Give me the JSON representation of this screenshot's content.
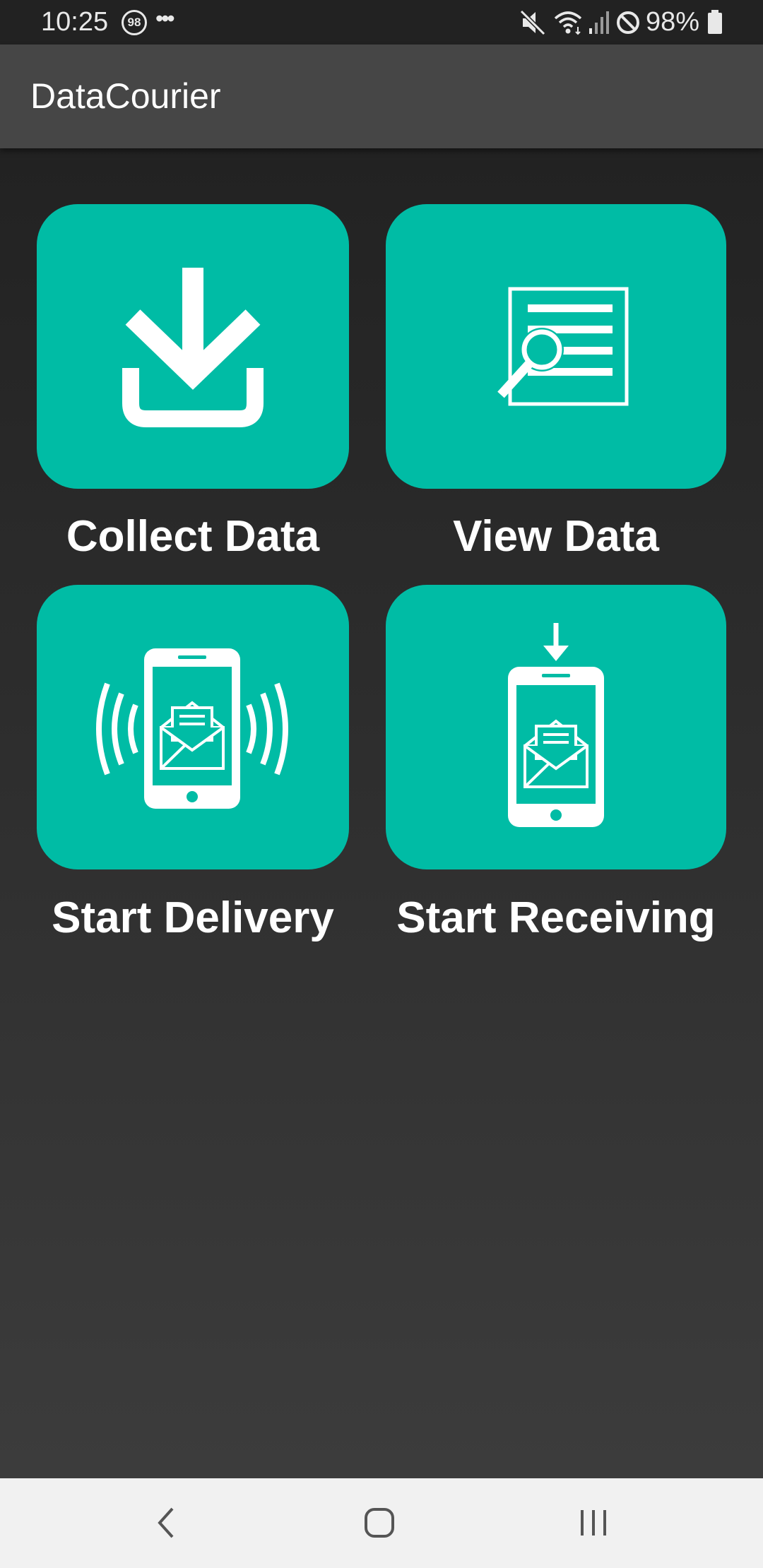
{
  "status_bar": {
    "time": "10:25",
    "notification_count": "98",
    "more_indicator": "•••",
    "battery": "98%",
    "icons": [
      "mute-icon",
      "wifi-icon",
      "signal-icon",
      "do-not-disturb-icon",
      "battery-icon"
    ]
  },
  "app_bar": {
    "title": "DataCourier"
  },
  "tiles": [
    {
      "label": "Collect Data",
      "icon": "download-icon"
    },
    {
      "label": "View Data",
      "icon": "document-search-icon"
    },
    {
      "label": "Start Delivery",
      "icon": "phone-broadcast-mail-icon"
    },
    {
      "label": "Start Receiving",
      "icon": "phone-receive-mail-icon"
    }
  ],
  "colors": {
    "accent": "#00bca5",
    "app_bar": "#464646",
    "background": "#222222",
    "nav_bar": "#f1f1f1"
  },
  "nav_bar": {
    "buttons": [
      "back-icon",
      "home-icon",
      "recent-apps-icon"
    ]
  }
}
